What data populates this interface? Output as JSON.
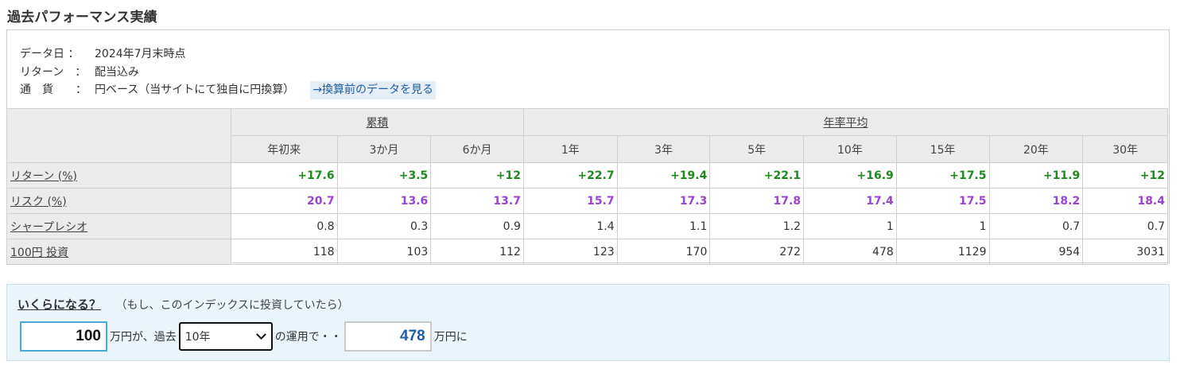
{
  "title": "過去パフォーマンス実績",
  "meta": {
    "date_label": "データ日 ：",
    "date_value": "2024年7月末時点",
    "return_label": "リターン　：",
    "return_value": "配当込み",
    "currency_label": "通　貨　　：",
    "currency_value": "円ベース（当サイトにて独自に円換算）",
    "currency_link": "→換算前のデータを見る"
  },
  "table": {
    "group_cumulative": "累積",
    "group_annual": "年率平均",
    "columns": [
      "年初来",
      "3か月",
      "6か月",
      "1年",
      "3年",
      "5年",
      "10年",
      "15年",
      "20年",
      "30年"
    ],
    "rows": [
      {
        "label": "リターン (%)",
        "values": [
          "+17.6",
          "+3.5",
          "+12",
          "+22.7",
          "+19.4",
          "+22.1",
          "+16.9",
          "+17.5",
          "+11.9",
          "+12"
        ]
      },
      {
        "label": "リスク (%)",
        "values": [
          "20.7",
          "13.6",
          "13.7",
          "15.7",
          "17.3",
          "17.8",
          "17.4",
          "17.5",
          "18.2",
          "18.4"
        ]
      },
      {
        "label": "シャープレシオ",
        "values": [
          "0.8",
          "0.3",
          "0.9",
          "1.4",
          "1.1",
          "1.2",
          "1",
          "1",
          "0.7",
          "0.7"
        ]
      },
      {
        "label": "100円 投資",
        "values": [
          "118",
          "103",
          "112",
          "123",
          "170",
          "272",
          "478",
          "1129",
          "954",
          "3031"
        ]
      }
    ]
  },
  "calc": {
    "question": "いくらになる？",
    "note": "（もし、このインデックスに投資していたら）",
    "amount_value": "100",
    "text_after_amount": "万円が、過去",
    "period_selected": "10年",
    "text_after_period": "の運用で・・",
    "result_value": "478",
    "text_after_result": "万円に"
  },
  "colors": {
    "return": "#1e8a1e",
    "risk": "#9944cc",
    "link": "#1a5ea8",
    "calc_bg": "#eaf6fb"
  }
}
